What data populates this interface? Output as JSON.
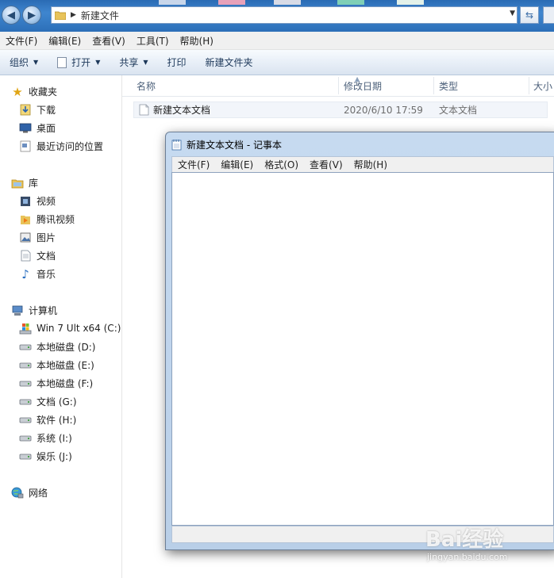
{
  "address": {
    "path": "新建文件"
  },
  "menu": [
    "文件(F)",
    "编辑(E)",
    "查看(V)",
    "工具(T)",
    "帮助(H)"
  ],
  "toolbar": {
    "organize": "组织",
    "open": "打开",
    "share": "共享",
    "print": "打印",
    "new_folder": "新建文件夹"
  },
  "nav": {
    "favorites": {
      "label": "收藏夹",
      "items": [
        "下载",
        "桌面",
        "最近访问的位置"
      ]
    },
    "libraries": {
      "label": "库",
      "items": [
        "视频",
        "腾讯视频",
        "图片",
        "文档",
        "音乐"
      ]
    },
    "computer": {
      "label": "计算机",
      "items": [
        "Win 7 Ult x64 (C:)",
        "本地磁盘 (D:)",
        "本地磁盘 (E:)",
        "本地磁盘 (F:)",
        "文档 (G:)",
        "软件 (H:)",
        "系统 (I:)",
        "娱乐 (J:)"
      ]
    },
    "network": {
      "label": "网络"
    }
  },
  "columns": {
    "name": "名称",
    "modified": "修改日期",
    "type": "类型",
    "size": "大小"
  },
  "files": [
    {
      "name": "新建文本文档",
      "modified": "2020/6/10 17:59",
      "type": "文本文档"
    }
  ],
  "notepad": {
    "title": "新建文本文档 - 记事本",
    "menu": [
      "文件(F)",
      "编辑(E)",
      "格式(O)",
      "查看(V)",
      "帮助(H)"
    ],
    "content": ""
  },
  "watermark": {
    "logo": "Bai经验",
    "url": "jingyan.baidu.com"
  },
  "colors": {
    "addressbar": "#3f86cf",
    "toolbar": "#e7eef7",
    "notepad_frame": "#c6daf0"
  },
  "icons": [
    "back-arrow-icon",
    "forward-arrow-icon",
    "folder-icon",
    "refresh-icon",
    "star-icon",
    "download-icon",
    "desktop-icon",
    "recent-icon",
    "library-icon",
    "video-icon",
    "tencent-video-icon",
    "picture-icon",
    "document-icon",
    "music-icon",
    "computer-icon",
    "drive-icon",
    "network-icon",
    "text-file-icon",
    "notepad-icon"
  ]
}
